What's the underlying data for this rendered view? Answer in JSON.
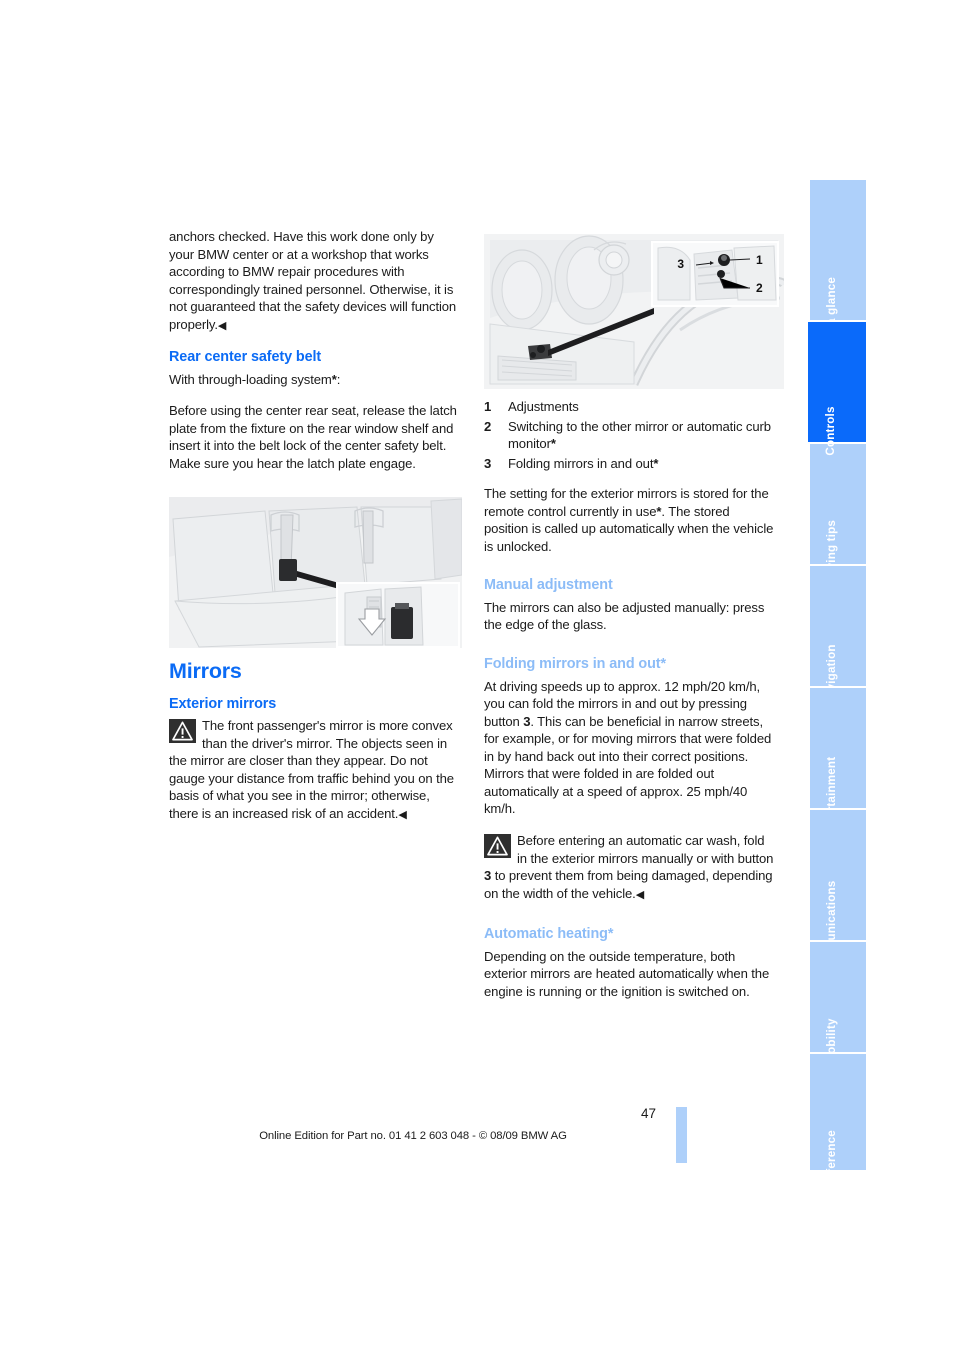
{
  "page": {
    "number": "47",
    "footer": "Online Edition for Part no. 01 41 2 603 048 - © 08/09 BMW AG",
    "accent_blue": "#0b6bf5",
    "light_blue": "#8cbcf7",
    "tab_blue": "#aed0fa",
    "tab_active_blue": "#0a6afa"
  },
  "left_column": {
    "continued_paragraph": "anchors checked. Have this work done only by your BMW center or at a workshop that works according to BMW repair procedures with correspondingly trained personnel. Otherwise, it is not guaranteed that the safety devices will function properly.",
    "end_marker": "◀",
    "heading_rear_belt": "Rear center safety belt",
    "through_loading": "With through-loading system",
    "through_loading_star": "*",
    "through_loading_colon": ":",
    "belt_instructions": "Before using the center rear seat, release the latch plate from the fixture on the rear window shelf and insert it into the belt lock of the center safety belt. Make sure you hear the latch plate engage.",
    "figure_seat_alt": "Rear seat bench with center safety belt latch plate, magnified inset showing latch plate and belt lock",
    "heading_mirrors": "Mirrors",
    "heading_exterior_mirrors": "Exterior mirrors",
    "warning_mirrors": "The front passenger's mirror is more convex than the driver's mirror. The objects seen in the mirror are closer than they appear. Do not gauge your distance from traffic behind you on the basis of what you see in the mirror; otherwise, there is an increased risk of an accident.",
    "warning_mirrors_end": "◀"
  },
  "right_column": {
    "figure_dash_alt": "Driver door controls with magnified inset of mirror adjustment buttons 1, 2 and 3",
    "figure_callouts": [
      "3",
      "1",
      "2"
    ],
    "legend": [
      {
        "num": "1",
        "text": "Adjustments",
        "star": ""
      },
      {
        "num": "2",
        "text": "Switching to the other mirror or automatic curb monitor",
        "star": "*"
      },
      {
        "num": "3",
        "text": "Folding mirrors in and out",
        "star": "*"
      }
    ],
    "stored_setting_pre": "The setting for the exterior mirrors is stored for the remote control currently in use",
    "stored_setting_star": "*",
    "stored_setting_post": ". The stored position is called up automatically when the vehicle is unlocked.",
    "heading_manual_adjustment": "Manual adjustment",
    "manual_adjustment_text": "The mirrors can also be adjusted manually: press the edge of the glass.",
    "heading_folding": "Folding mirrors in and out*",
    "folding_pre": "At driving speeds up to approx. 12 mph/20 km/h, you can fold the mirrors in and out by pressing button ",
    "folding_button": "3",
    "folding_post": ". This can be beneficial in narrow streets, for example, or for moving mirrors that were folded in by hand back out into their correct positions. Mirrors that were folded in are folded out automatically at a speed of approx. 25 mph/40 km/h.",
    "warning_carwash_pre": "Before entering an automatic car wash, fold in the exterior mirrors manually or with button ",
    "warning_carwash_button": "3",
    "warning_carwash_post": " to prevent them from being damaged, depending on the width of the vehicle.",
    "warning_carwash_end": "◀",
    "heading_auto_heating": "Automatic heating*",
    "auto_heating_text": "Depending on the outside temperature, both exterior mirrors are heated automatically when the engine is running or the ignition is switched on."
  },
  "tabs": [
    {
      "label": "At a glance",
      "active": false
    },
    {
      "label": "Controls",
      "active": true
    },
    {
      "label": "Driving tips",
      "active": false
    },
    {
      "label": "Navigation",
      "active": false
    },
    {
      "label": "Entertainment",
      "active": false
    },
    {
      "label": "Communications",
      "active": false
    },
    {
      "label": "Mobility",
      "active": false
    },
    {
      "label": "Reference",
      "active": false
    }
  ]
}
